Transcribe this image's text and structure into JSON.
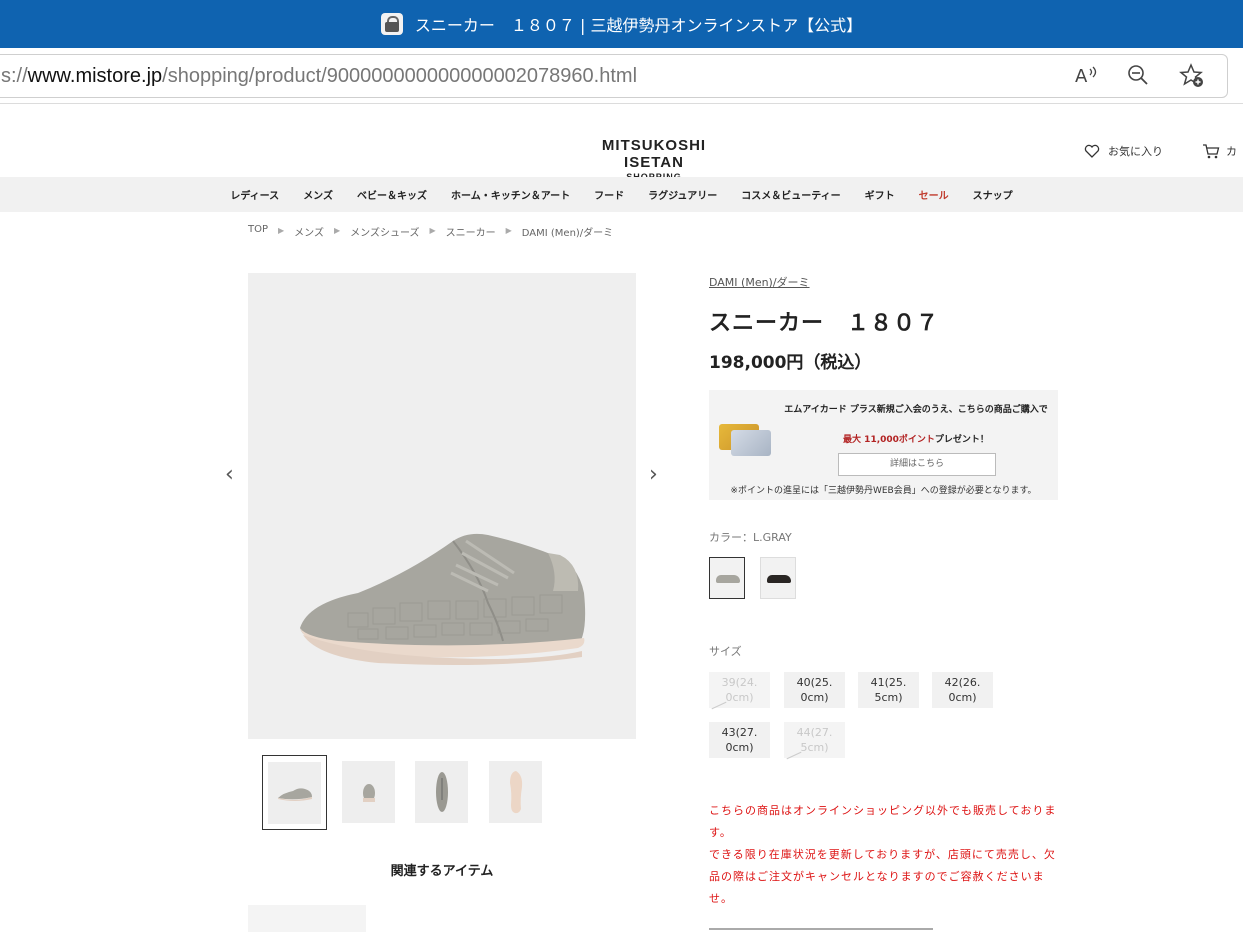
{
  "window": {
    "title": "スニーカー　１８０７ | 三越伊勢丹オンラインストア【公式】"
  },
  "address_bar": {
    "scheme_prefix": "s://",
    "host": "www.mistore.jp",
    "path": "/shopping/product/900000000000000002078960.html",
    "icons": [
      "read-aloud-icon",
      "zoom-out-icon",
      "add-favorite-icon"
    ]
  },
  "site_header": {
    "logo_line1": "MITSUKOSHI ISETAN",
    "logo_line2": "SHOPPING",
    "favorites_label": "お気に入り",
    "cart_label": "カ"
  },
  "nav": {
    "items": [
      "レディース",
      "メンズ",
      "ベビー＆キッズ",
      "ホーム・キッチン＆アート",
      "フード",
      "ラグジュアリー",
      "コスメ＆ビューティー",
      "ギフト",
      "セール",
      "スナップ"
    ],
    "sale_color": "#c0392b"
  },
  "breadcrumb": [
    "TOP",
    "メンズ",
    "メンズシューズ",
    "スニーカー",
    "DAMI (Men)/ダーミ"
  ],
  "product": {
    "brand": "DAMI (Men)/ダーミ",
    "name": "スニーカー　１８０７",
    "price": "198,000円（税込）",
    "color_label": "カラー：L.GRAY",
    "colors": [
      "L.GRAY",
      "BLACK"
    ],
    "size_label": "サイズ",
    "sizes": [
      {
        "label1": "39(24.",
        "label2": "0cm)",
        "available": false
      },
      {
        "label1": "40(25.",
        "label2": "0cm)",
        "available": true
      },
      {
        "label1": "41(25.",
        "label2": "5cm)",
        "available": true
      },
      {
        "label1": "42(26.",
        "label2": "0cm)",
        "available": true
      },
      {
        "label1": "43(27.",
        "label2": "0cm)",
        "available": true
      },
      {
        "label1": "44(27.",
        "label2": "5cm)",
        "available": false
      }
    ]
  },
  "promo": {
    "line1": "エムアイカード プラス新規ご入会のうえ、こちらの商品ご購入で",
    "highlight": "最大 11,000ポイント",
    "line2_suffix": "プレゼント！",
    "button": "詳細はこちら",
    "note": "※ポイントの進呈には「三越伊勢丹WEB会員」への登録が必要となります。"
  },
  "related": {
    "title": "関連するアイテム"
  },
  "notice": {
    "line1": "こちらの商品はオンラインショッピング以外でも販売しております。",
    "line2": "できる限り在庫状況を更新しておりますが、店頭にて売売し、欠品の際はご注文がキャンセルとなりますのでご容赦くださいませ。"
  }
}
